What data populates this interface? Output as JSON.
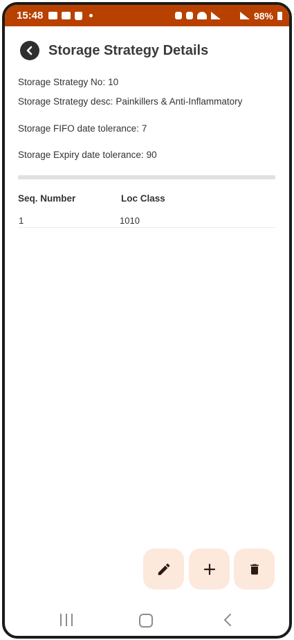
{
  "status_bar": {
    "time": "15:48",
    "battery": "98%"
  },
  "header": {
    "title": "Storage Strategy Details"
  },
  "details": {
    "strategy_no_label": "Storage Strategy No:",
    "strategy_no_value": "10",
    "strategy_desc_label": "Storage Strategy desc:",
    "strategy_desc_value": "Painkillers & Anti-Inflammatory",
    "fifo_label": "Storage FIFO date tolerance:",
    "fifo_value": "7",
    "expiry_label": "Storage Expiry date tolerance:",
    "expiry_value": "90"
  },
  "table": {
    "columns": [
      "Seq. Number",
      "Loc Class"
    ],
    "rows": [
      [
        "1",
        "1010"
      ]
    ]
  },
  "actions": {
    "edit_icon": "pencil-icon",
    "add_icon": "plus-icon",
    "delete_icon": "trash-icon"
  },
  "colors": {
    "status_bar": "#b84100",
    "fab_background": "#fde8dc"
  }
}
